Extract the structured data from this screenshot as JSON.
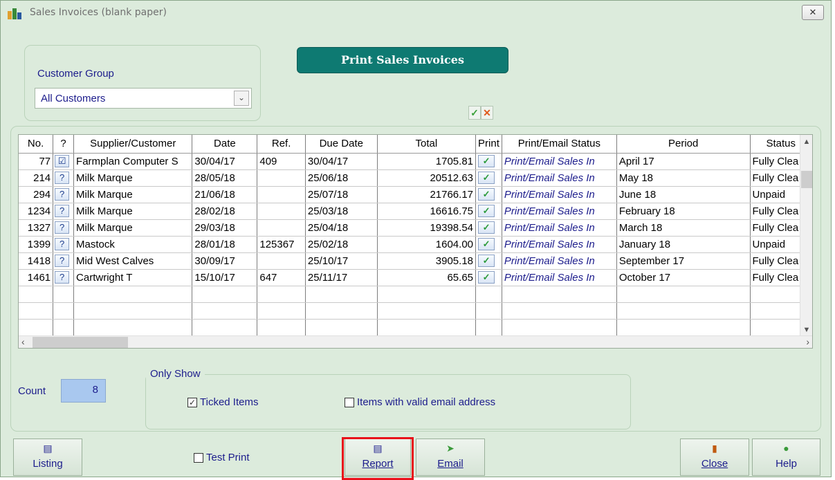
{
  "window": {
    "title": "Sales Invoices  (blank paper)",
    "close_glyph": "✕"
  },
  "customer_group": {
    "label": "Customer Group",
    "value": "All Customers"
  },
  "header_button": "Print Sales Invoices",
  "grid": {
    "columns": [
      "No.",
      "?",
      "Supplier/Customer",
      "Date",
      "Ref.",
      "Due Date",
      "Total",
      "Print",
      "Print/Email Status",
      "Period",
      "Status"
    ],
    "rows": [
      {
        "no": "77",
        "q": "☑",
        "customer": "Farmplan Computer S",
        "date": "30/04/17",
        "ref": "409",
        "due": "30/04/17",
        "total": "1705.81",
        "print": "✓",
        "status_text": "Print/Email Sales In",
        "period": "April 17",
        "status": "Fully Clea"
      },
      {
        "no": "214",
        "q": "?",
        "customer": "Milk Marque",
        "date": "28/05/18",
        "ref": "",
        "due": "25/06/18",
        "total": "20512.63",
        "print": "✓",
        "status_text": "Print/Email Sales In",
        "period": "May 18",
        "status": "Fully Clea"
      },
      {
        "no": "294",
        "q": "?",
        "customer": "Milk Marque",
        "date": "21/06/18",
        "ref": "",
        "due": "25/07/18",
        "total": "21766.17",
        "print": "✓",
        "status_text": "Print/Email Sales In",
        "period": "June 18",
        "status": "Unpaid"
      },
      {
        "no": "1234",
        "q": "?",
        "customer": "Milk Marque",
        "date": "28/02/18",
        "ref": "",
        "due": "25/03/18",
        "total": "16616.75",
        "print": "✓",
        "status_text": "Print/Email Sales In",
        "period": "February 18",
        "status": "Fully Clea"
      },
      {
        "no": "1327",
        "q": "?",
        "customer": "Milk Marque",
        "date": "29/03/18",
        "ref": "",
        "due": "25/04/18",
        "total": "19398.54",
        "print": "✓",
        "status_text": "Print/Email Sales In",
        "period": "March 18",
        "status": "Fully Clea"
      },
      {
        "no": "1399",
        "q": "?",
        "customer": "Mastock",
        "date": "28/01/18",
        "ref": "125367",
        "due": "25/02/18",
        "total": "1604.00",
        "print": "✓",
        "status_text": "Print/Email Sales In",
        "period": "January 18",
        "status": "Unpaid"
      },
      {
        "no": "1418",
        "q": "?",
        "customer": "Mid West Calves",
        "date": "30/09/17",
        "ref": "",
        "due": "25/10/17",
        "total": "3905.18",
        "print": "✓",
        "status_text": "Print/Email Sales In",
        "period": "September 17",
        "status": "Fully Clea"
      },
      {
        "no": "1461",
        "q": "?",
        "customer": "Cartwright T",
        "date": "15/10/17",
        "ref": "647",
        "due": "25/11/17",
        "total": "65.65",
        "print": "✓",
        "status_text": "Print/Email Sales In",
        "period": "October 17",
        "status": "Fully Clea"
      }
    ]
  },
  "count": {
    "label": "Count",
    "value": "8"
  },
  "only_show": {
    "label": "Only Show",
    "ticked_items": {
      "label": "Ticked Items",
      "checked": true
    },
    "valid_email": {
      "label": "Items with valid email address",
      "checked": false
    }
  },
  "test_print": {
    "label": "Test Print",
    "checked": false
  },
  "buttons": {
    "listing": "Listing",
    "report": "Report",
    "email": "Email",
    "close": "Close",
    "help": "Help"
  },
  "colors": {
    "title_button": "#0e7a72",
    "window_bg": "#dcebdc",
    "highlight": "#e8101a",
    "count_box": "#a9c8ef"
  }
}
